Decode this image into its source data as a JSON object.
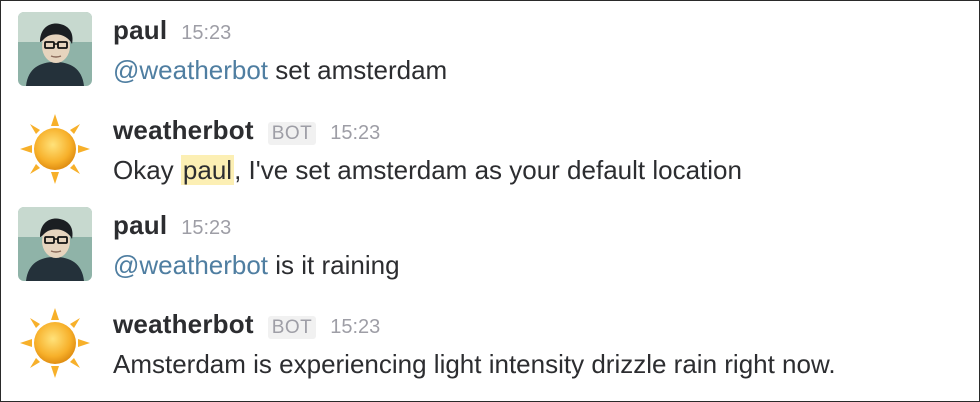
{
  "messages": [
    {
      "author": "paul",
      "time": "15:23",
      "mention": "@weatherbot",
      "text": " set amsterdam"
    },
    {
      "author": "weatherbot",
      "badge": "BOT",
      "time": "15:23",
      "text_pre": "Okay ",
      "highlight": "paul",
      "text_post": ", I've set amsterdam as your default location"
    },
    {
      "author": "paul",
      "time": "15:23",
      "mention": "@weatherbot",
      "text": " is it raining"
    },
    {
      "author": "weatherbot",
      "badge": "BOT",
      "time": "15:23",
      "text": "Amsterdam is experiencing light intensity drizzle rain right now."
    }
  ],
  "icons": {
    "user_avatar": "person-photo-avatar",
    "bot_avatar": "sun-icon"
  },
  "colors": {
    "mention": "#4f7ea1",
    "highlight": "#fcefb4",
    "name": "#2c2d30",
    "meta": "#9e9ea6"
  }
}
